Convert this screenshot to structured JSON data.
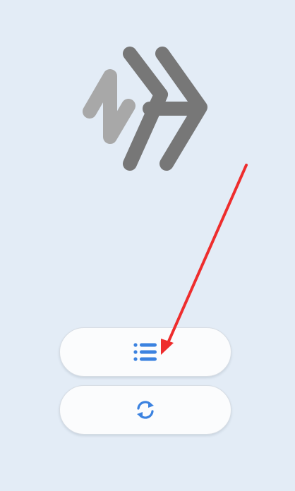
{
  "app": {
    "logo_icon": "nh-chevron-logo-icon",
    "logo_colors": {
      "light": "#a8a8a8",
      "dark": "#777777"
    }
  },
  "buttons": [
    {
      "name": "list-button",
      "icon": "list-icon",
      "icon_color": "#3b82e0"
    },
    {
      "name": "refresh-button",
      "icon": "refresh-icon",
      "icon_color": "#3b82e0"
    }
  ],
  "annotation": {
    "arrow_color": "#ee2d2d",
    "points_to": "list-button"
  },
  "theme": {
    "background": "#e3ecf6",
    "button_background": "#fbfcfd"
  }
}
